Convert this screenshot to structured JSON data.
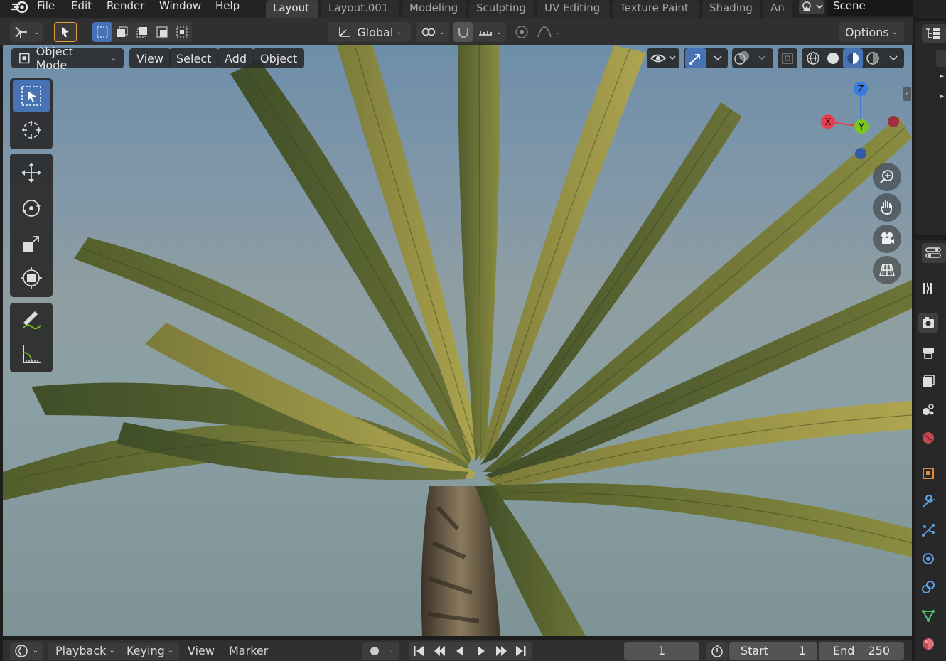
{
  "menubar": {
    "logo_icon": "blender-logo-icon",
    "items": [
      "File",
      "Edit",
      "Render",
      "Window",
      "Help"
    ]
  },
  "workspaces": {
    "tabs": [
      "Layout",
      "Layout.001",
      "Modeling",
      "Sculpting",
      "UV Editing",
      "Texture Paint",
      "Shading",
      "An"
    ],
    "active": "Layout"
  },
  "scene": {
    "icon": "scene-icon",
    "name": "Scene"
  },
  "viewport_header": {
    "editor_type_icon": "3d-viewport-icon",
    "orientation": "Global",
    "options_label": "Options"
  },
  "viewport_menu": {
    "mode": "Object Mode",
    "items": [
      "View",
      "Select",
      "Add",
      "Object"
    ]
  },
  "toolbar": {
    "tools": [
      "select-box-icon",
      "cursor-icon",
      "move-icon",
      "rotate-icon",
      "scale-icon",
      "transform-icon",
      "annotate-icon",
      "measure-icon"
    ],
    "active": "select-box-icon"
  },
  "gizmo": {
    "x": "X",
    "y": "Y",
    "z": "Z"
  },
  "nav_buttons": [
    "zoom-icon",
    "hand-pan-icon",
    "camera-icon",
    "grid-icon"
  ],
  "timeline": {
    "editor_icon": "timeline-icon",
    "menus": [
      "Playback",
      "Keying",
      "View",
      "Marker"
    ],
    "current_frame": "1",
    "start_label": "Start",
    "start_value": "1",
    "end_label": "End",
    "end_value": "250"
  },
  "properties_tabs": [
    "tool-icon",
    "render-icon",
    "output-icon",
    "view-layer-icon",
    "scene-props-icon",
    "world-icon",
    "object-icon",
    "modifier-icon",
    "particles-icon",
    "physics-icon",
    "constraints-icon",
    "data-icon",
    "material-icon"
  ],
  "colors": {
    "accent": "#4772b3",
    "axis_x": "#e63e4e",
    "axis_y": "#7cc520",
    "axis_z": "#3a7ce0"
  }
}
